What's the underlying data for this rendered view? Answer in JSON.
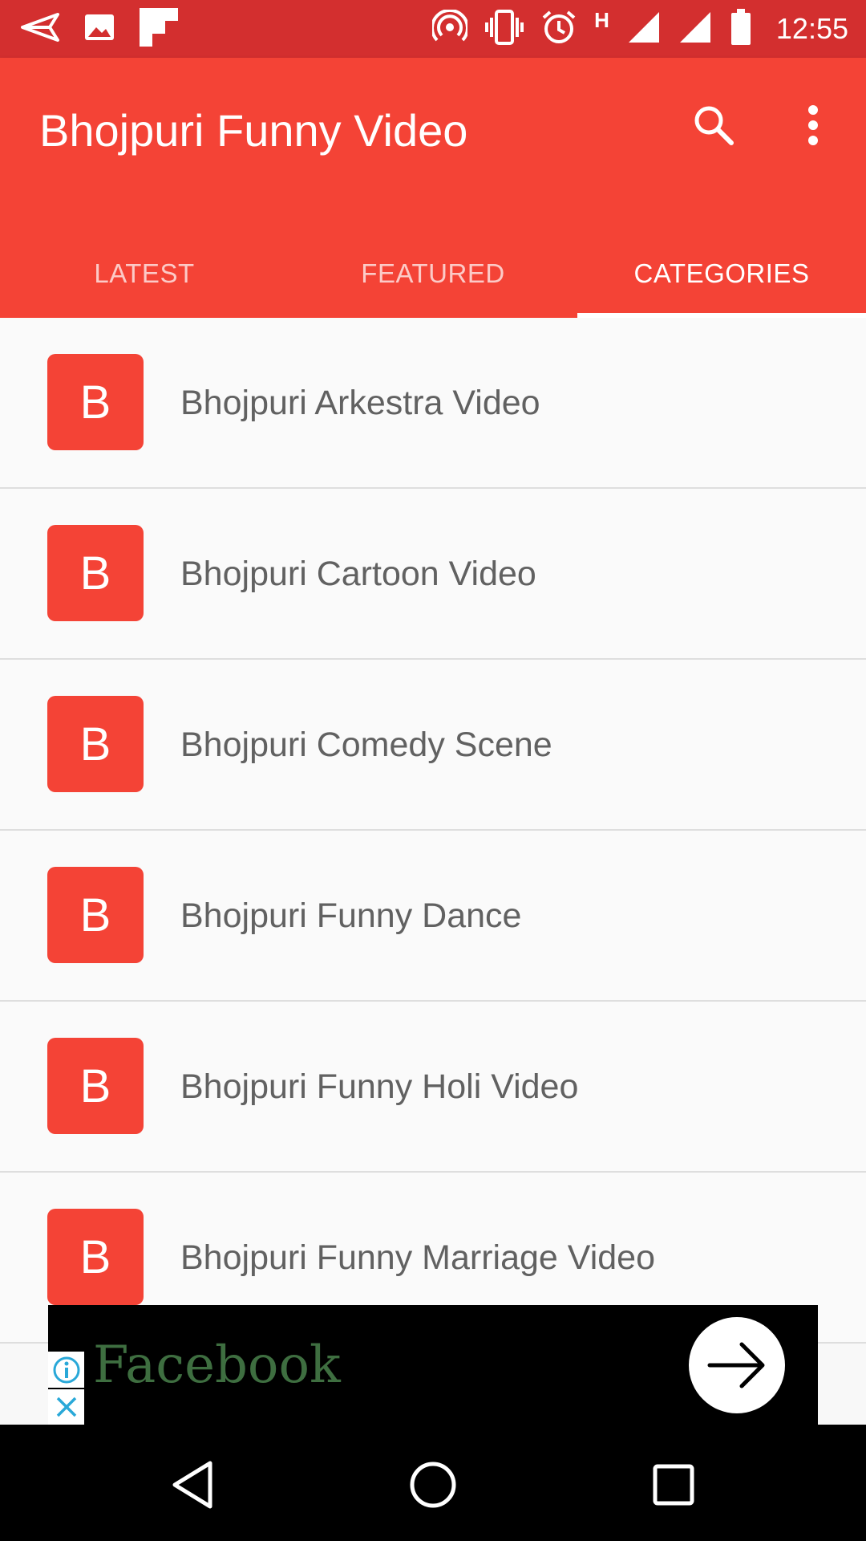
{
  "status_bar": {
    "time": "12:55",
    "network_type": "H",
    "icons": [
      "send-icon",
      "image-icon",
      "flipboard-icon",
      "hotspot-icon",
      "vibrate-icon",
      "alarm-icon",
      "signal-icon",
      "signal-icon",
      "battery-icon"
    ]
  },
  "app_bar": {
    "title": "Bhojpuri Funny Video",
    "color": "#f44336",
    "status_color": "#d32f2f"
  },
  "tabs": [
    {
      "label": "LATEST",
      "active": false
    },
    {
      "label": "FEATURED",
      "active": false
    },
    {
      "label": "CATEGORIES",
      "active": true
    }
  ],
  "categories": [
    {
      "letter": "B",
      "label": "Bhojpuri Arkestra Video"
    },
    {
      "letter": "B",
      "label": "Bhojpuri Cartoon Video"
    },
    {
      "letter": "B",
      "label": "Bhojpuri Comedy Scene"
    },
    {
      "letter": "B",
      "label": "Bhojpuri Funny Dance"
    },
    {
      "letter": "B",
      "label": "Bhojpuri Funny Holi Video"
    },
    {
      "letter": "B",
      "label": "Bhojpuri Funny Marriage Video"
    }
  ],
  "ad": {
    "text": "Facebook"
  }
}
